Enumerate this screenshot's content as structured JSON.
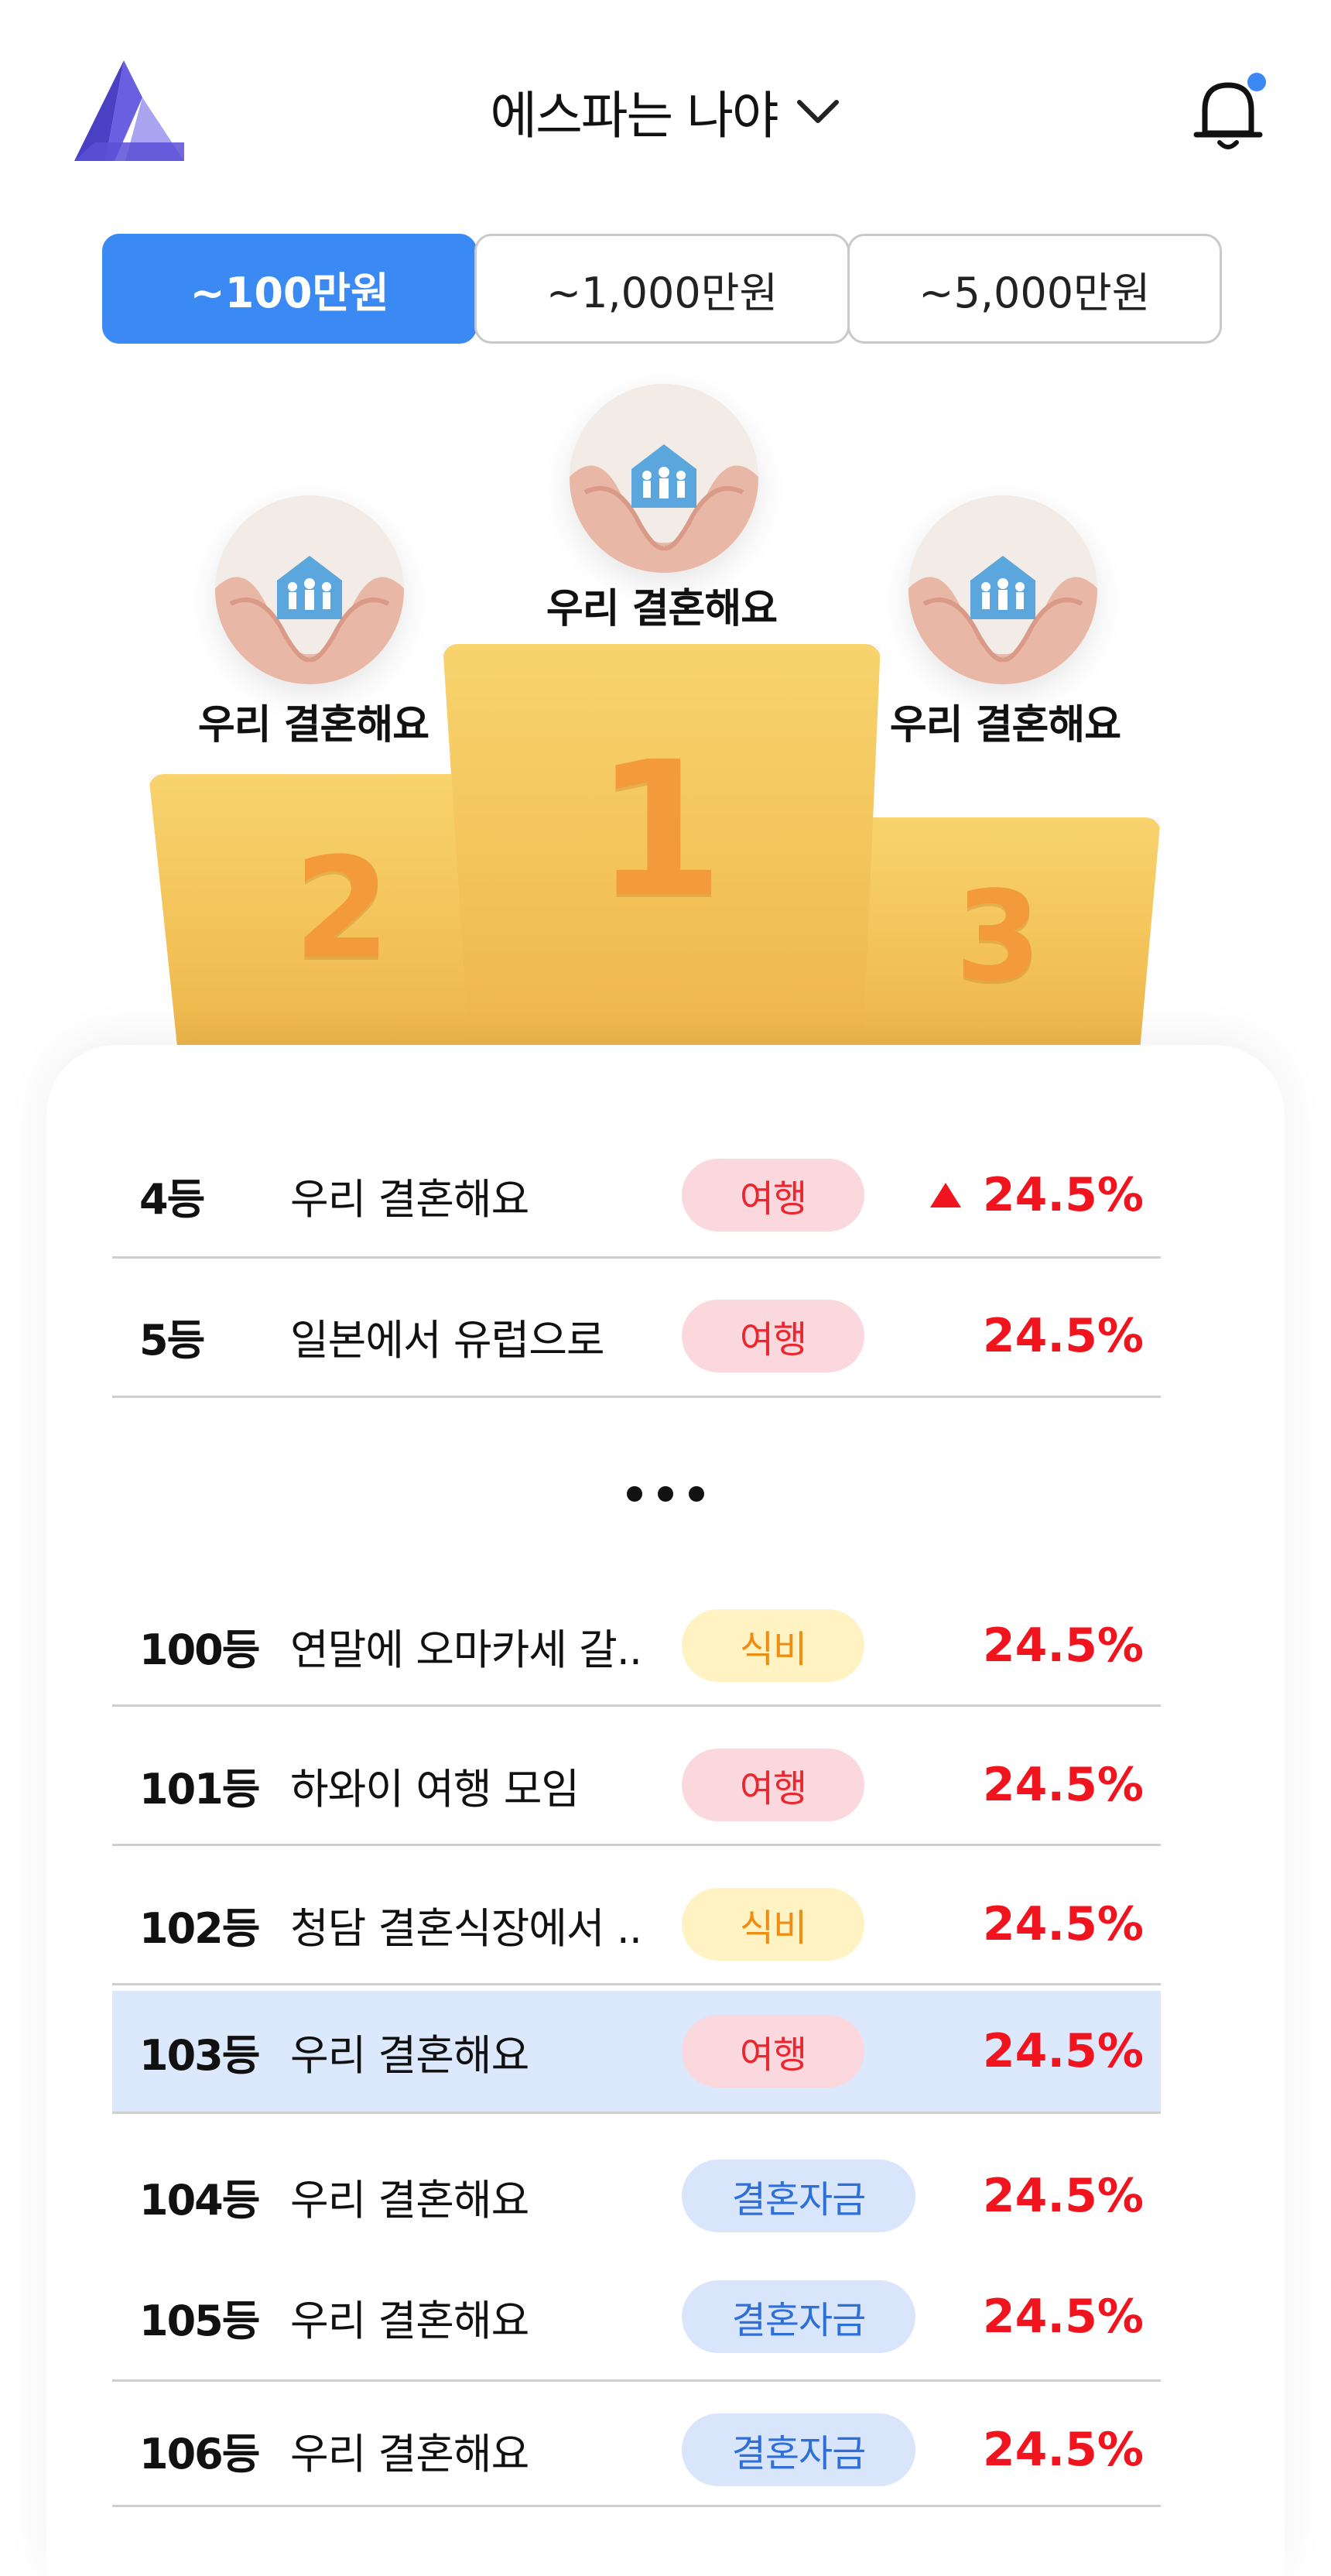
{
  "header": {
    "title": "에스파는 나야",
    "logo_icon": "logo-triangle-icon",
    "bell_icon": "bell-icon",
    "notification_dot_color": "#3b8af4"
  },
  "tabs": [
    {
      "label": "~100만원",
      "active": true
    },
    {
      "label": "~1,000만원",
      "active": false
    },
    {
      "label": "~5,000만원",
      "active": false
    }
  ],
  "podium": {
    "first": {
      "name": "우리 결혼해요",
      "rank": "1"
    },
    "second": {
      "name": "우리 결혼해요",
      "rank": "2"
    },
    "third": {
      "name": "우리 결혼해요",
      "rank": "3"
    }
  },
  "ranking": [
    {
      "rank": "4등",
      "name": "우리 결혼해요",
      "category": "여행",
      "percent": "24.5%",
      "trend": "up"
    },
    {
      "rank": "5등",
      "name": "일본에서 유럽으로",
      "category": "여행",
      "percent": "24.5%"
    },
    {
      "rank": "100등",
      "name": "연말에 오마카세 갈..",
      "category": "식비",
      "percent": "24.5%"
    },
    {
      "rank": "101등",
      "name": "하와이 여행 모임",
      "category": "여행",
      "percent": "24.5%"
    },
    {
      "rank": "102등",
      "name": "청담 결혼식장에서 ..",
      "category": "식비",
      "percent": "24.5%"
    },
    {
      "rank": "103등",
      "name": "우리 결혼해요",
      "category": "여행",
      "percent": "24.5%",
      "highlighted": true
    },
    {
      "rank": "104등",
      "name": "우리 결혼해요",
      "category": "결혼자금",
      "percent": "24.5%"
    },
    {
      "rank": "105등",
      "name": "우리 결혼해요",
      "category": "결혼자금",
      "percent": "24.5%"
    },
    {
      "rank": "106등",
      "name": "우리 결혼해요",
      "category": "결혼자금",
      "percent": "24.5%"
    }
  ],
  "colors": {
    "accent": "#3b8af4",
    "percent_red": "#f0141e",
    "highlight_row": "#dce8fb",
    "podium_gold": "#f3c45a",
    "podium_number": "#f39a3a"
  }
}
